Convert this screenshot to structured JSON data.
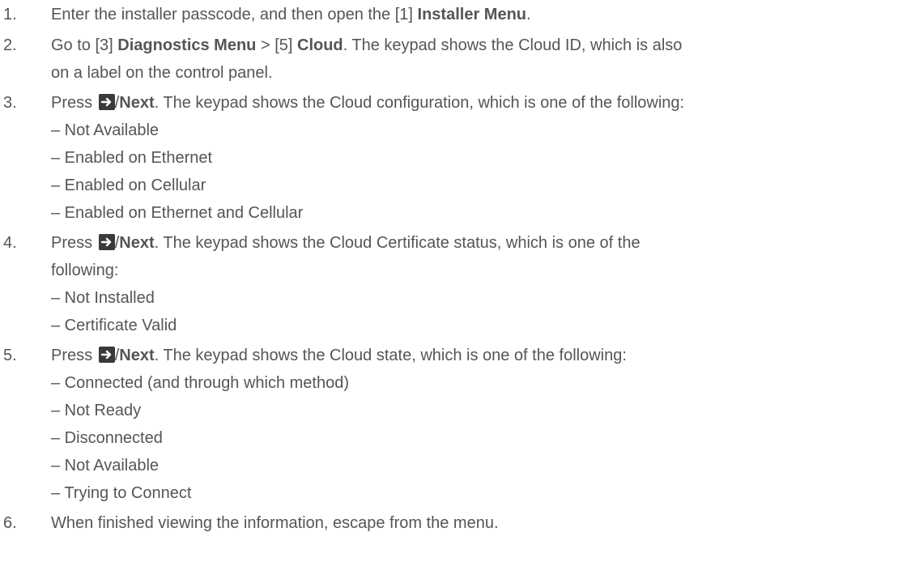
{
  "steps": [
    {
      "num": "1.",
      "lines": [
        {
          "pre": "Enter the installer passcode, and then open the [1] ",
          "bold1": "Installer Menu",
          "post": "."
        }
      ]
    },
    {
      "num": "2.",
      "lines": [
        {
          "pre": "Go to [3] ",
          "bold1": "Diagnostics Menu",
          "mid": " > [5] ",
          "bold2": "Cloud",
          "post": ". The keypad shows the Cloud ID, which is also"
        },
        {
          "text": "on a label on the control panel."
        }
      ]
    },
    {
      "num": "3.",
      "lines": [
        {
          "press": "Press ",
          "slash": "/",
          "bold1": "Next",
          "post": ". The keypad shows the Cloud configuration, which is one of the following:"
        }
      ],
      "options": [
        "– Not Available",
        "– Enabled on Ethernet",
        "– Enabled on Cellular",
        "– Enabled on Ethernet and Cellular"
      ]
    },
    {
      "num": "4.",
      "lines": [
        {
          "press": "Press ",
          "slash": "/",
          "bold1": "Next",
          "post": ". The keypad shows the Cloud Certificate status, which is one of the"
        },
        {
          "text": "following:"
        }
      ],
      "options": [
        "– Not Installed",
        "– Certificate Valid"
      ]
    },
    {
      "num": "5.",
      "lines": [
        {
          "press": "Press ",
          "slash": "/",
          "bold1": "Next",
          "post": ". The keypad shows the Cloud state, which is one of the following:"
        }
      ],
      "options": [
        "– Connected (and through which method)",
        "– Not Ready",
        "– Disconnected",
        "– Not Available",
        "– Trying to Connect"
      ]
    },
    {
      "num": "6.",
      "lines": [
        {
          "text": "When finished viewing the information, escape from the menu."
        }
      ]
    }
  ],
  "icons": {
    "next_key": "right-arrow-key-icon"
  },
  "colors": {
    "text": "#555555",
    "key_bg": "#3a3a3a"
  }
}
